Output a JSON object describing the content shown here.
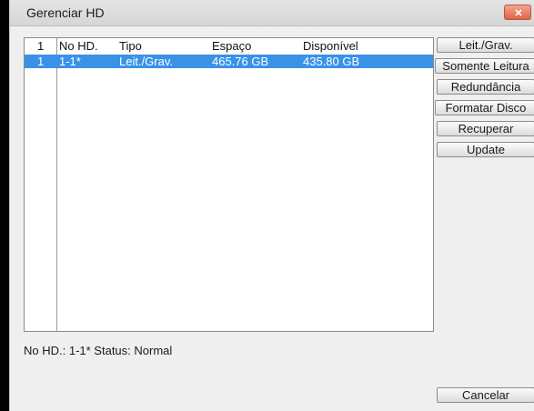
{
  "window": {
    "title": "Gerenciar HD"
  },
  "table": {
    "columns": [
      "1",
      "No HD.",
      "Tipo",
      "Espaço",
      "Disponível"
    ],
    "rows": [
      {
        "idx": "1",
        "hd": "1-1*",
        "tipo": "Leit./Grav.",
        "espaco": "465.76 GB",
        "disponivel": "435.80 GB",
        "selected": true
      }
    ]
  },
  "buttons": {
    "leit_grav": "Leit./Grav.",
    "somente_leitura": "Somente Leitura",
    "redundancia": "Redundância",
    "formatar_disco": "Formatar Disco",
    "recuperar": "Recuperar",
    "update": "Update",
    "cancelar": "Cancelar"
  },
  "status": {
    "text": "No HD.: 1-1* Status: Normal"
  },
  "colors": {
    "selection": "#3a92e6",
    "close": "#e0634a"
  }
}
